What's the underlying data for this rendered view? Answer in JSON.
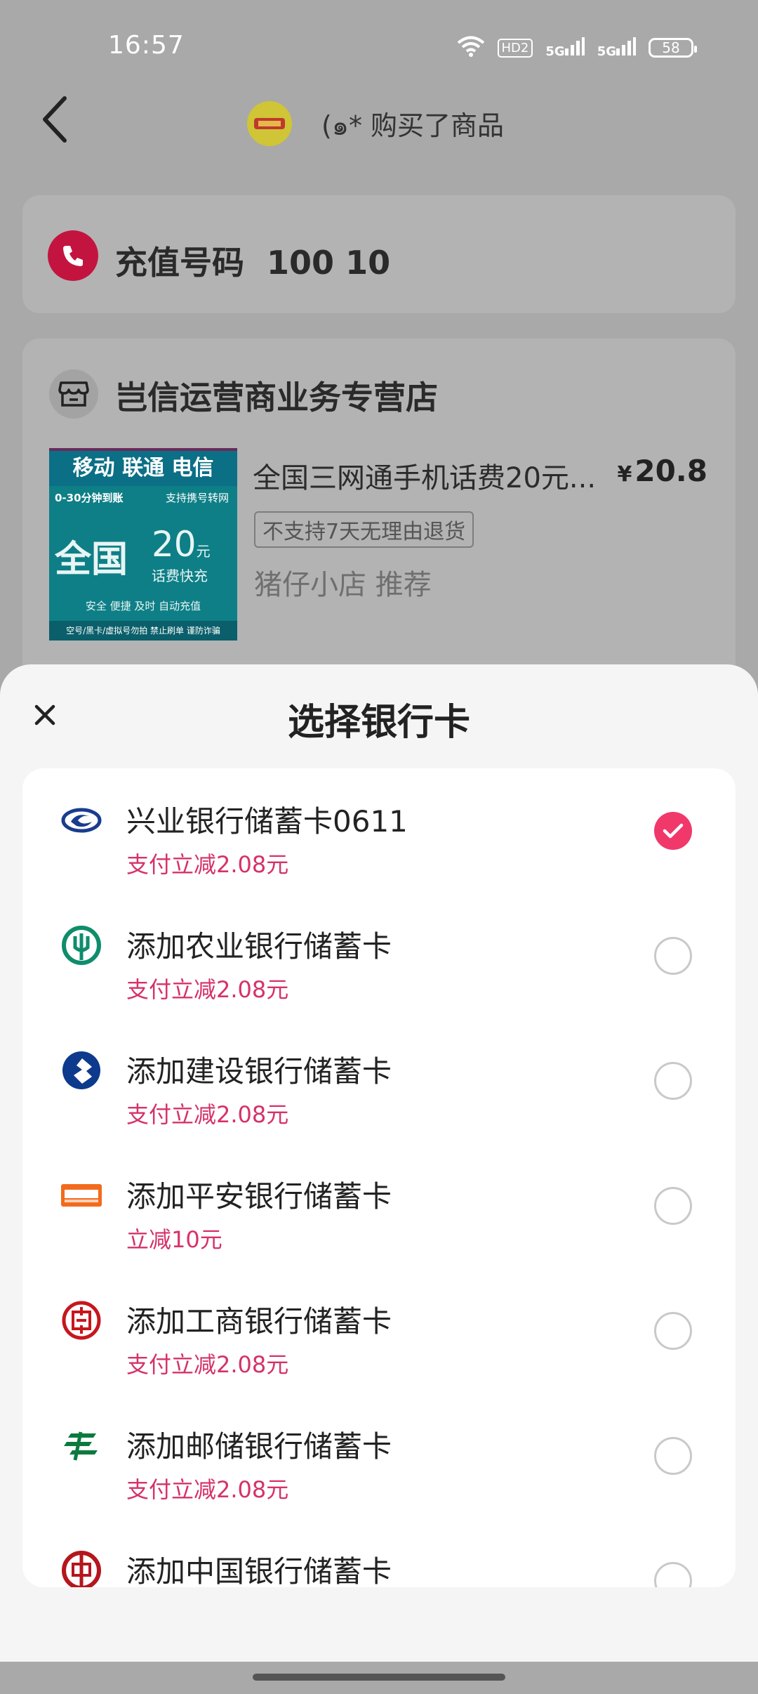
{
  "status_bar": {
    "time": "16:57",
    "hd_label": "HD2",
    "sig1_label": "5G",
    "sig2_label": "5G",
    "battery": "58",
    "icons": [
      "wifi-icon",
      "hd-icon",
      "signal-5g-icon",
      "signal-5g-icon",
      "battery-icon"
    ]
  },
  "header": {
    "back_icon": "chevron-left-icon",
    "title": "(๑* 购买了商品"
  },
  "phone_card": {
    "label": "充值号码",
    "number": "100 10"
  },
  "shop": {
    "name": "岂信运营商业务专营店",
    "product": {
      "image_text": {
        "carriers": "移动 联通 电信",
        "speed": "0-30分钟到账",
        "transfer": "支持携号转网",
        "region": "全国",
        "amount": "20",
        "unit": "元",
        "fast": "话费快充",
        "features": "安全 便捷 及时 自动充值",
        "warning": "空号/黑卡/虚拟号勿拍 禁止刷单 谨防诈骗"
      },
      "title": "全国三网通手机话费20元...",
      "currency": "¥",
      "price": "20.8",
      "tag": "不支持7天无理由退货",
      "recommend": "猪仔小店 推荐"
    }
  },
  "sheet": {
    "close_icon": "close-icon",
    "title": "选择银行卡",
    "banks": [
      {
        "name": "兴业银行储蓄卡0611",
        "promo": "支付立减2.08元",
        "icon": "cib-logo-icon",
        "color": "#1a3c8f",
        "selected": true
      },
      {
        "name": "添加农业银行储蓄卡",
        "promo": "支付立减2.08元",
        "icon": "abc-logo-icon",
        "color": "#0f8c6c",
        "selected": false
      },
      {
        "name": "添加建设银行储蓄卡",
        "promo": "支付立减2.08元",
        "icon": "ccb-logo-icon",
        "color": "#0d3a8c",
        "selected": false
      },
      {
        "name": "添加平安银行储蓄卡",
        "promo": "立减10元",
        "icon": "pingan-logo-icon",
        "color": "#f26b1d",
        "selected": false
      },
      {
        "name": "添加工商银行储蓄卡",
        "promo": "支付立减2.08元",
        "icon": "icbc-logo-icon",
        "color": "#c7161d",
        "selected": false
      },
      {
        "name": "添加邮储银行储蓄卡",
        "promo": "支付立减2.08元",
        "icon": "psbc-logo-icon",
        "color": "#0b7a3e",
        "selected": false
      },
      {
        "name": "添加中国银行储蓄卡",
        "promo": "",
        "icon": "boc-logo-icon",
        "color": "#b5161e",
        "selected": false
      }
    ]
  },
  "colors": {
    "accent": "#f0386b",
    "promo": "#d5326a",
    "phone_icon_bg": "#c3143f",
    "overlay": "#a9a9a9"
  }
}
